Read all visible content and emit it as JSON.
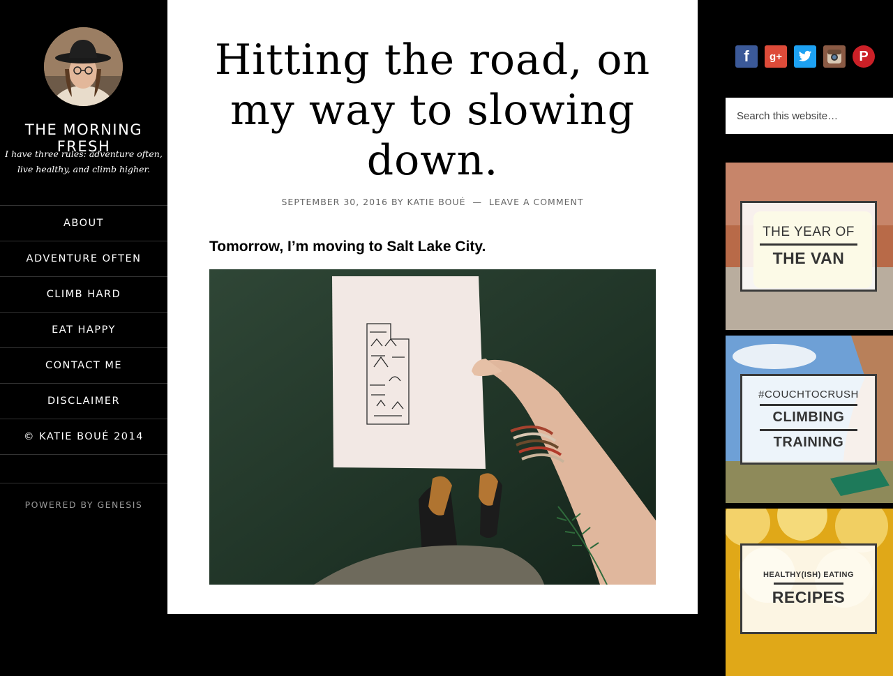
{
  "site": {
    "title": "THE MORNING FRESH",
    "description": "I have three rules: adventure often, live healthy, and climb higher."
  },
  "nav": {
    "items": [
      {
        "label": "ABOUT"
      },
      {
        "label": "ADVENTURE OFTEN"
      },
      {
        "label": "CLIMB HARD"
      },
      {
        "label": "EAT HAPPY"
      },
      {
        "label": "CONTACT ME"
      },
      {
        "label": "DISCLAIMER"
      },
      {
        "label": "© KATIE BOUÉ 2014"
      }
    ]
  },
  "footer": {
    "powered_prefix": "POWERED BY",
    "powered_link": "GENESIS"
  },
  "post": {
    "title": "Hitting the road, on my way to slowing down.",
    "date": "SEPTEMBER 30, 2016",
    "by": "BY",
    "author": "KATIE BOUÉ",
    "dash": "—",
    "comment_link": "LEAVE A COMMENT",
    "lead": "Tomorrow, I’m moving to Salt Lake City."
  },
  "social": {
    "icons": [
      "facebook-icon",
      "google-plus-icon",
      "twitter-icon",
      "instagram-icon",
      "pinterest-icon"
    ],
    "colors": {
      "facebook": "#3b5998",
      "google_plus": "#dd4b39",
      "twitter": "#1da1f2",
      "instagram": "#8a5a44",
      "pinterest": "#cb2027"
    },
    "facebook_glyph": "f",
    "google_glyph": "g+",
    "pinterest_glyph": "P"
  },
  "search": {
    "placeholder": "Search this website…"
  },
  "promos": [
    {
      "line1": "THE YEAR OF",
      "line2": "THE VAN"
    },
    {
      "line1": "#COUCHTOCRUSH",
      "line2": "CLIMBING",
      "line3": "TRAINING"
    },
    {
      "line1": "HEALTHY(ISH) EATING",
      "line2": "RECIPES"
    }
  ]
}
